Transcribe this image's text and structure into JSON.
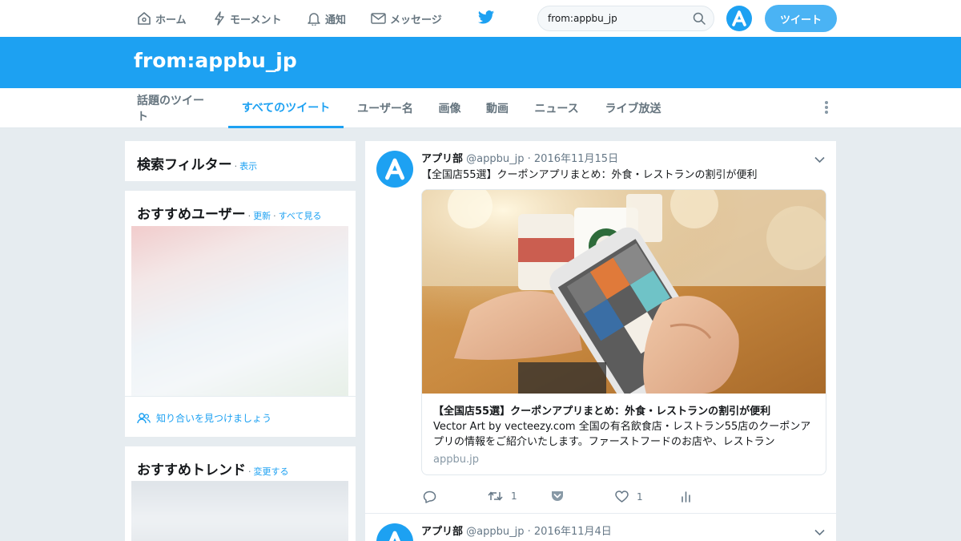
{
  "nav": {
    "home": "ホーム",
    "moments": "モーメント",
    "notifications": "通知",
    "messages": "メッセージ",
    "search_value": "from:appbu_jp",
    "tweet_button": "ツイート"
  },
  "search_title": "from:appbu_jp",
  "tabs": [
    {
      "label": "話題のツイート",
      "active": false
    },
    {
      "label": "すべてのツイート",
      "active": true
    },
    {
      "label": "ユーザー名",
      "active": false
    },
    {
      "label": "画像",
      "active": false
    },
    {
      "label": "動画",
      "active": false
    },
    {
      "label": "ニュース",
      "active": false
    },
    {
      "label": "ライブ放送",
      "active": false
    }
  ],
  "sidebar": {
    "filter": {
      "title": "検索フィルター",
      "sep": "·",
      "link": "表示"
    },
    "who_to_follow": {
      "title": "おすすめユーザー",
      "sep": "·",
      "refresh": "更新",
      "sep2": "·",
      "view_all": "すべて見る",
      "find_friends": "知り合いを見つけましょう"
    },
    "trends": {
      "title": "おすすめトレンド",
      "sep": "·",
      "change": "変更する"
    }
  },
  "tweets": [
    {
      "name": "アプリ部",
      "handle": "@appbu_jp",
      "dot": "·",
      "date": "2016年11月15日",
      "text": "【全国店55選】クーポンアプリまとめ：外食・レストランの割引が便利",
      "card": {
        "title": "【全国店55選】クーポンアプリまとめ：外食・レストランの割引が便利",
        "description": "Vector Art by vecteezy.com 全国の有名飲食店・レストラン55店のクーポンアプリの情報をご紹介いたします。ファーストフードのお店や、レストラン",
        "domain": "appbu.jp"
      },
      "retweets": "1",
      "likes": "1"
    },
    {
      "name": "アプリ部",
      "handle": "@appbu_jp",
      "dot": "·",
      "date": "2016年11月4日"
    }
  ],
  "colors": {
    "accent": "#1da1f2",
    "background": "#e6ecf0",
    "text": "#14171a",
    "muted": "#657786"
  }
}
